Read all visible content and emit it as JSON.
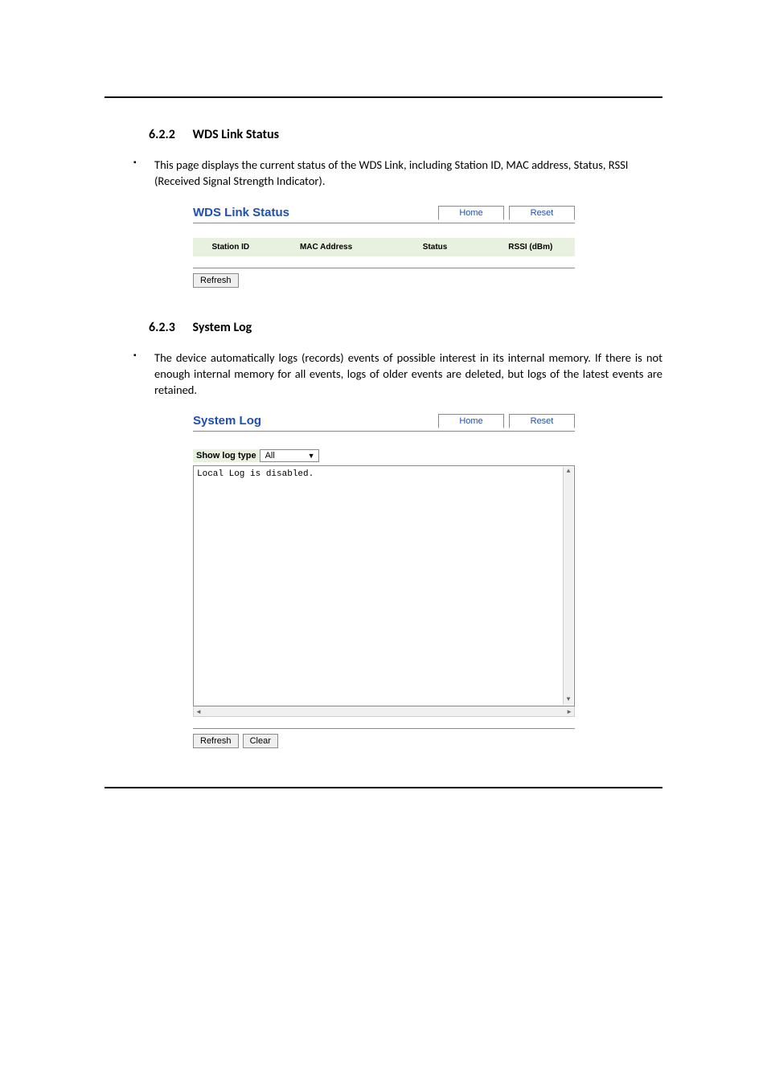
{
  "sections": {
    "wds": {
      "number": "6.2.2",
      "title": "WDS Link Status",
      "bullet": "This page displays the current status of the WDS Link, including Station ID, MAC address, Status, RSSI (Received Signal Strength Indicator)."
    },
    "syslog": {
      "number": "6.2.3",
      "title": "System Log",
      "bullet": "The device automatically logs (records) events of possible interest in its internal memory. If there is not enough internal memory for all events, logs of older events are deleted, but logs of the latest events are retained."
    }
  },
  "wds_panel": {
    "title": "WDS Link Status",
    "home": "Home",
    "reset": "Reset",
    "columns": {
      "station_id": "Station ID",
      "mac": "MAC Address",
      "status": "Status",
      "rssi": "RSSI (dBm)"
    },
    "refresh": "Refresh"
  },
  "syslog_panel": {
    "title": "System Log",
    "home": "Home",
    "reset": "Reset",
    "show_label": "Show log type",
    "select_value": "All",
    "log_text": "Local Log is disabled.",
    "refresh": "Refresh",
    "clear": "Clear"
  }
}
